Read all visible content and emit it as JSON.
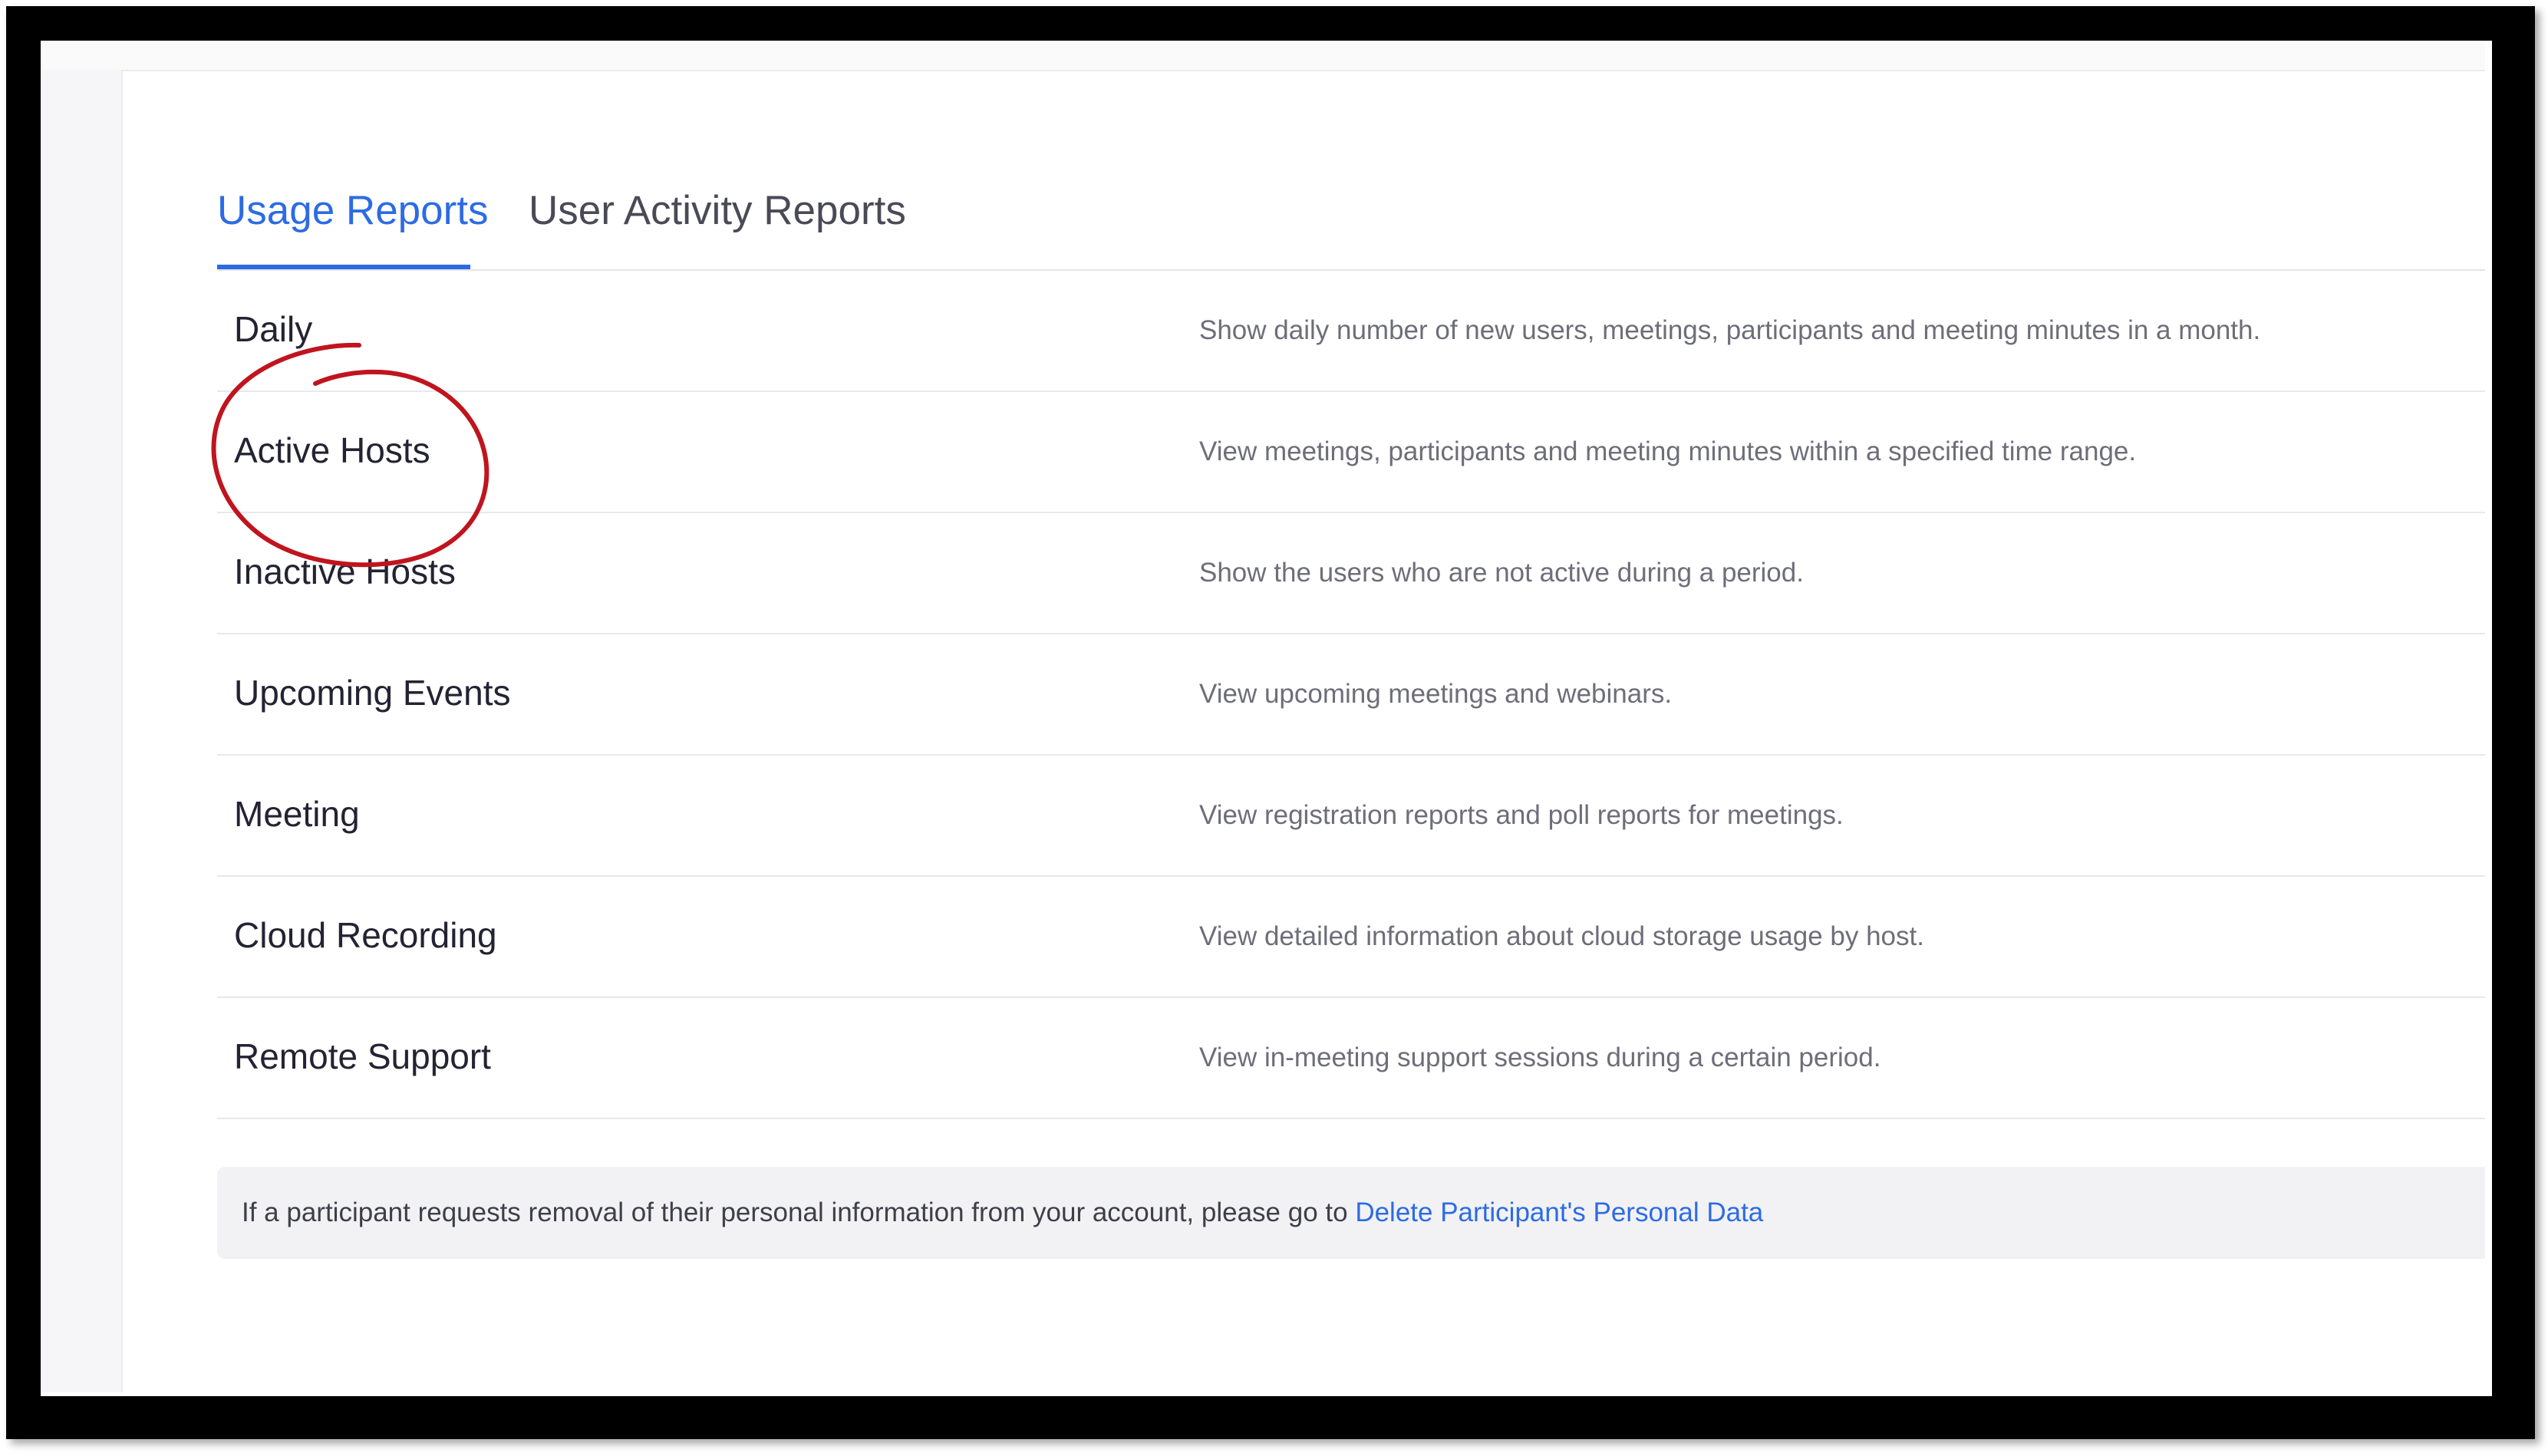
{
  "tabs": [
    {
      "label": "Usage Reports",
      "active": true
    },
    {
      "label": "User Activity Reports",
      "active": false
    }
  ],
  "reports": [
    {
      "name": "Daily",
      "description": "Show daily number of new users, meetings, participants and meeting minutes in a month."
    },
    {
      "name": "Active Hosts",
      "description": "View meetings, participants and meeting minutes within a specified time range."
    },
    {
      "name": "Inactive Hosts",
      "description": "Show the users who are not active during a period."
    },
    {
      "name": "Upcoming Events",
      "description": "View upcoming meetings and webinars."
    },
    {
      "name": "Meeting",
      "description": "View registration reports and poll reports for meetings."
    },
    {
      "name": "Cloud Recording",
      "description": "View detailed information about cloud storage usage by host."
    },
    {
      "name": "Remote Support",
      "description": "View in-meeting support sessions during a certain period."
    }
  ],
  "notice": {
    "text": "If a participant requests removal of their personal information from your account, please go to ",
    "link_label": "Delete Participant's Personal Data"
  },
  "colors": {
    "accent": "#2d6be4",
    "annotation": "#c0141e",
    "text_primary": "#232333",
    "text_secondary": "#6e6e7a"
  },
  "annotation": {
    "highlighted_item": "Active Hosts",
    "shape": "hand-drawn-circle"
  }
}
